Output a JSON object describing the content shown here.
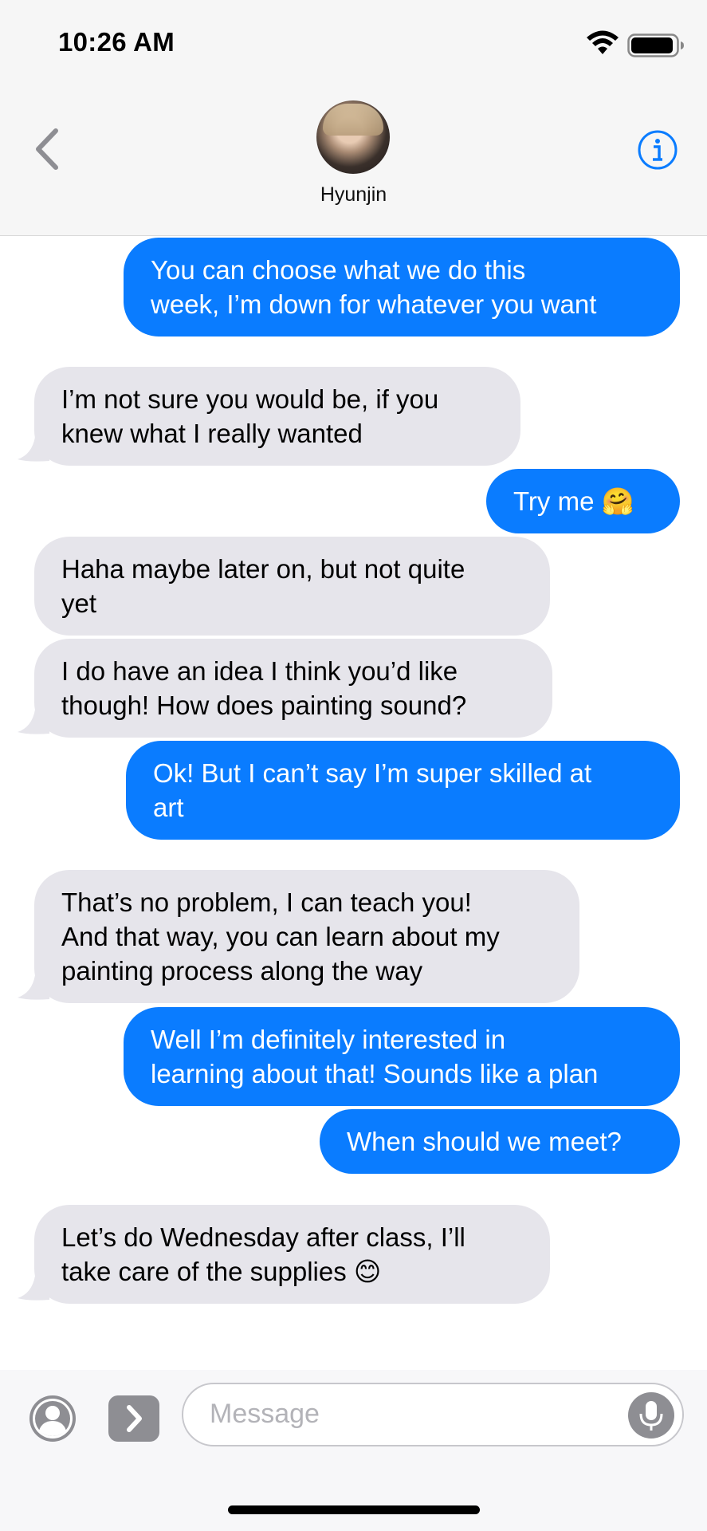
{
  "status_bar": {
    "time": "10:26 AM",
    "icons": [
      "wifi-icon",
      "battery-icon"
    ]
  },
  "header": {
    "contact_name": "Hyunjin",
    "back_icon": "chevron-left-icon",
    "info_icon": "info-icon"
  },
  "messages": [
    {
      "from": "me",
      "text": "You can choose what we do this\nweek, I’m down for whatever you want"
    },
    {
      "from": "them",
      "text": "I’m not sure you would be, if you\nknew what I really wanted"
    },
    {
      "from": "me",
      "text": "Try me 🤗"
    },
    {
      "from": "them",
      "text": "Haha maybe later on, but not quite\nyet"
    },
    {
      "from": "them",
      "text": "I do have an idea I think you’d like\nthough! How does painting sound?"
    },
    {
      "from": "me",
      "text": "Ok! But I can’t say I’m super skilled at\nart"
    },
    {
      "from": "them",
      "text": "That’s no problem, I can teach you!\nAnd that way, you can learn about my\npainting process along the way"
    },
    {
      "from": "me",
      "text": "Well I’m definitely interested in\nlearning about that! Sounds like a plan"
    },
    {
      "from": "me",
      "text": "When should we meet?"
    },
    {
      "from": "them",
      "text": "Let’s do Wednesday after class, I’ll\ntake care of the supplies 😊"
    }
  ],
  "input_bar": {
    "placeholder": "Message",
    "icons": [
      "contact-card-icon",
      "apps-chevron-icon",
      "microphone-icon"
    ]
  },
  "colors": {
    "sent_bubble": "#0a7cff",
    "received_bubble": "#e6e5eb",
    "accent": "#0a7cff"
  }
}
